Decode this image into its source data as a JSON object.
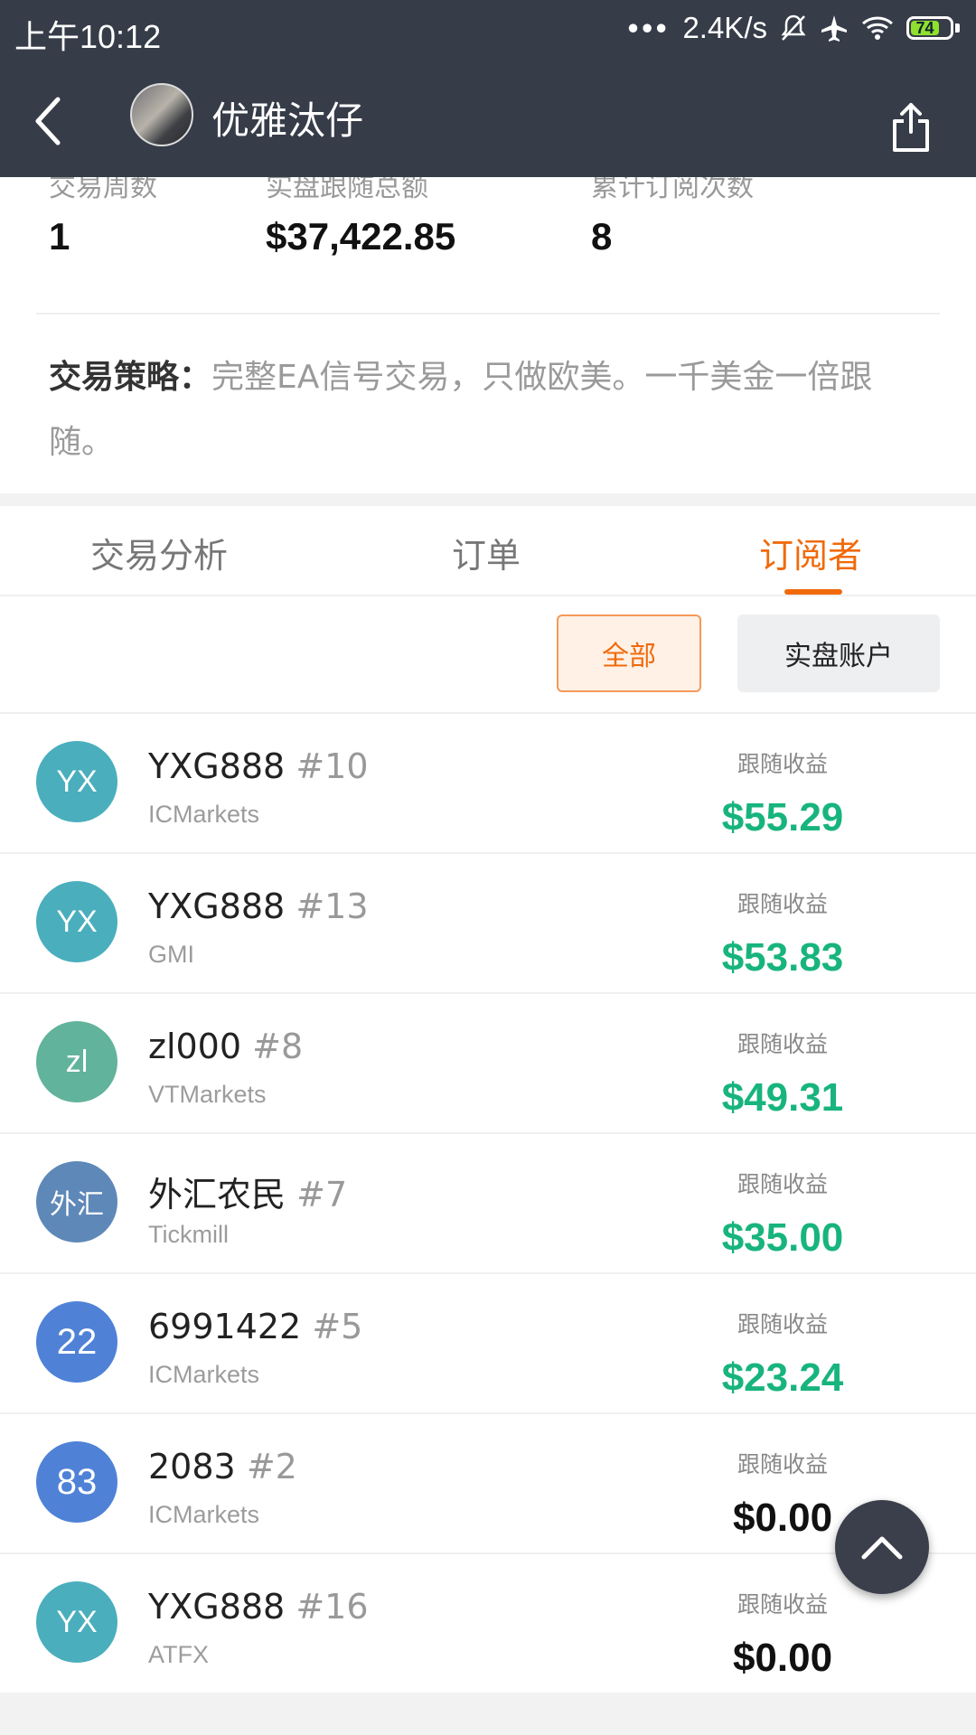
{
  "status_bar": {
    "time": "上午10:12",
    "network_speed": "2.4K/s",
    "battery": "74"
  },
  "header": {
    "title": "优雅汰仔"
  },
  "summary": {
    "stats": [
      {
        "label": "交易周数",
        "value": "1"
      },
      {
        "label": "实盘跟随总额",
        "value": "$37,422.85"
      },
      {
        "label": "累计订阅次数",
        "value": "8"
      }
    ],
    "strategy_label": "交易策略：",
    "strategy_text": "完整EA信号交易，只做欧美。一千美金一倍跟随。"
  },
  "tabs": [
    {
      "label": "交易分析",
      "active": false
    },
    {
      "label": "订单",
      "active": false
    },
    {
      "label": "订阅者",
      "active": true
    }
  ],
  "filters": {
    "all": "全部",
    "real": "实盘账户"
  },
  "subscribers": [
    {
      "initials": "YX",
      "color": "#4aaebd",
      "name": "YXG888",
      "rank": "#10",
      "broker": "ICMarkets",
      "profit_label": "跟随收益",
      "profit": "$55.29",
      "positive": true
    },
    {
      "initials": "YX",
      "color": "#4aaebd",
      "name": "YXG888",
      "rank": "#13",
      "broker": "GMI",
      "profit_label": "跟随收益",
      "profit": "$53.83",
      "positive": true
    },
    {
      "initials": "zl",
      "color": "#62b39b",
      "name": "zl000",
      "rank": "#8",
      "broker": "VTMarkets",
      "profit_label": "跟随收益",
      "profit": "$49.31",
      "positive": true
    },
    {
      "initials": "外汇",
      "color": "#5e88b8",
      "name": "外汇农民",
      "rank": "#7",
      "broker": "Tickmill",
      "profit_label": "跟随收益",
      "profit": "$35.00",
      "positive": true
    },
    {
      "initials": "22",
      "color": "#4f82d6",
      "name": "6991422",
      "rank": "#5",
      "broker": "ICMarkets",
      "profit_label": "跟随收益",
      "profit": "$23.24",
      "positive": true
    },
    {
      "initials": "83",
      "color": "#4f82d6",
      "name": "2083",
      "rank": "#2",
      "broker": "ICMarkets",
      "profit_label": "跟随收益",
      "profit": "$0.00",
      "positive": false
    },
    {
      "initials": "YX",
      "color": "#4aaebd",
      "name": "YXG888",
      "rank": "#16",
      "broker": "ATFX",
      "profit_label": "跟随收益",
      "profit": "$0.00",
      "positive": false
    }
  ],
  "icons": {
    "back": "back-arrow-icon",
    "share": "share-icon",
    "scroll_top": "chevron-up-icon"
  }
}
